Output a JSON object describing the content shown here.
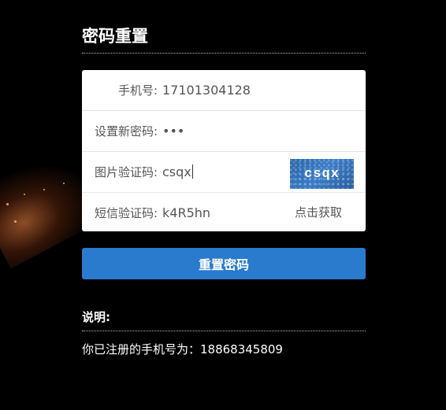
{
  "page_title": "密码重置",
  "form": {
    "phone": {
      "label": "手机号:",
      "value": "17101304128"
    },
    "new_password": {
      "label": "设置新密码:",
      "value": "•••"
    },
    "image_captcha": {
      "label": "图片验证码:",
      "value": "csqx",
      "captcha_text": "csqx"
    },
    "sms_code": {
      "label": "短信验证码:",
      "value": "k4R5hn",
      "button_label": "点击获取"
    }
  },
  "submit_label": "重置密码",
  "notes": {
    "title": "说明:",
    "text": "你已注册的手机号为：18868345809"
  },
  "colors": {
    "background": "#000000",
    "primary_button": "#2a7acd",
    "captcha_bg": "#2f6db5"
  }
}
